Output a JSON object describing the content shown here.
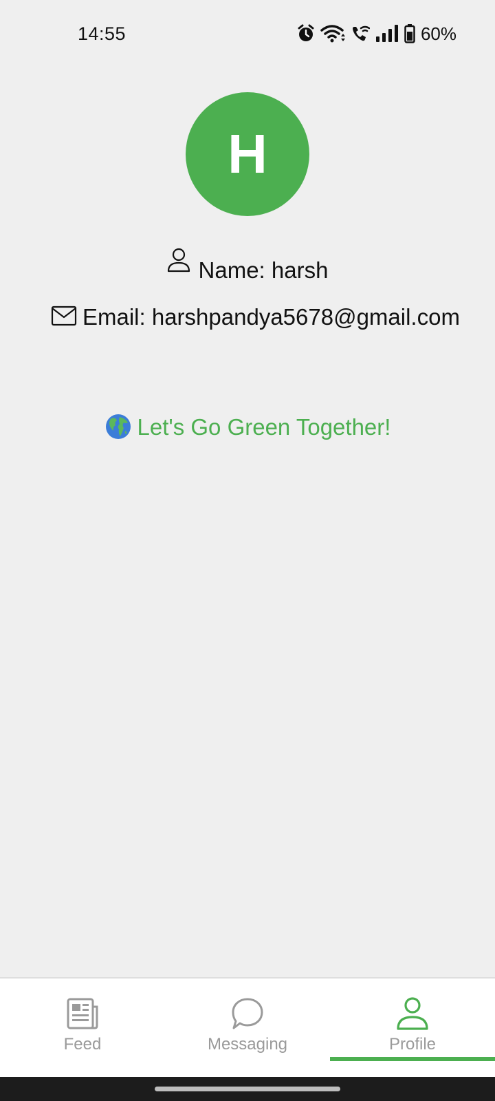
{
  "status_bar": {
    "time": "14:55",
    "battery_percent": "60%",
    "icons": [
      "alarm-icon",
      "wifi-icon",
      "wifi-call-icon",
      "signal-icon",
      "battery-icon"
    ]
  },
  "profile": {
    "avatar_initial": "H",
    "name_text": "Name: harsh",
    "email_text": "Email: harshpandya5678@gmail.com",
    "tagline": "Let's Go Green Together!"
  },
  "bottom_nav": {
    "items": [
      {
        "label": "Feed",
        "icon": "newspaper-icon"
      },
      {
        "label": "Messaging",
        "icon": "chat-bubble-icon"
      },
      {
        "label": "Profile",
        "icon": "person-icon"
      }
    ],
    "active": "Profile"
  },
  "colors": {
    "accent": "#4caf50",
    "background": "#efefef",
    "nav_background": "#ffffff",
    "inactive_icon": "#9a9a9a"
  }
}
